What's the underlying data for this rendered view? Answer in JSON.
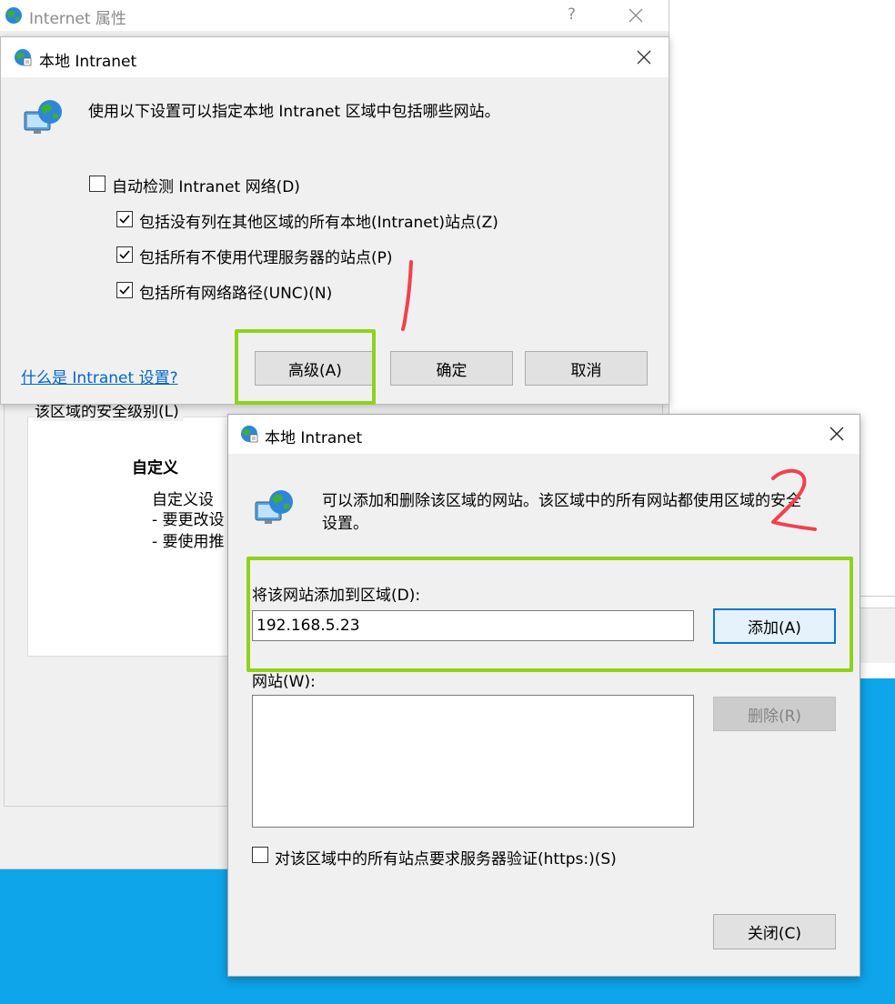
{
  "colors": {
    "desktop_blue": "#0ea5ea",
    "dialog_bg": "#f0f0f0",
    "highlight_green": "#90d21a",
    "annotation_red": "#f2414d",
    "focus_blue": "#0078d7",
    "link_blue": "#0066cc"
  },
  "bg_window": {
    "title": "Internet 属性",
    "help_glyph": "?",
    "zone_group_label": "该区域的安全级别(L)",
    "custom_title": "自定义",
    "custom_lines": [
      "自定义设",
      "- 要更改设",
      "- 要使用推"
    ]
  },
  "dialog1": {
    "title": "本地 Intranet",
    "description": "使用以下设置可以指定本地 Intranet 区域中包括哪些网站。",
    "checkboxes": [
      {
        "label": "自动检测 Intranet 网络(D)",
        "checked": false
      },
      {
        "label": "包括没有列在其他区域的所有本地(Intranet)站点(Z)",
        "checked": true
      },
      {
        "label": "包括所有不使用代理服务器的站点(P)",
        "checked": true
      },
      {
        "label": "包括所有网络路径(UNC)(N)",
        "checked": true
      }
    ],
    "help_link": "什么是 Intranet 设置?",
    "advanced_button": "高级(A)",
    "ok_button": "确定",
    "cancel_button": "取消",
    "annotation_step": "1"
  },
  "dialog2": {
    "title": "本地 Intranet",
    "description_line1": "可以添加和删除该区域的网站。该区域中的所有网站都使用区域的安全",
    "description_line2": "设置。",
    "add_label": "将该网站添加到区域(D):",
    "add_input_value": "192.168.5.23",
    "add_button": "添加(A)",
    "websites_label": "网站(W):",
    "remove_button": "删除(R)",
    "https_checkbox": {
      "label": "对该区域中的所有站点要求服务器验证(https:)(S)",
      "checked": false
    },
    "close_button": "关闭(C)",
    "annotation_step": "2"
  }
}
